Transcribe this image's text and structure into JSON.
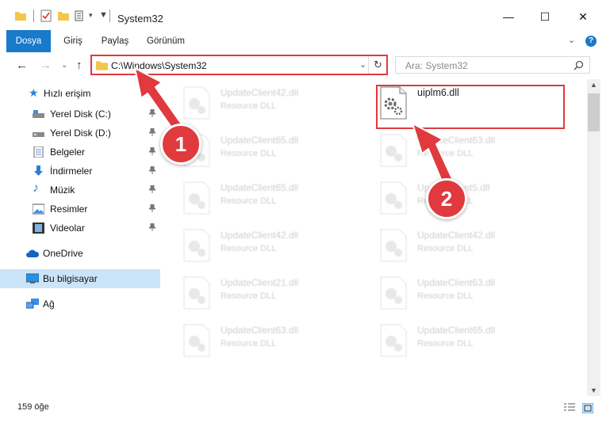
{
  "window": {
    "title": "System32",
    "controls": {
      "minimize": "—",
      "maximize": "☐",
      "close": "✕"
    }
  },
  "ribbon": {
    "tabs": [
      "Dosya",
      "Giriş",
      "Paylaş",
      "Görünüm"
    ]
  },
  "navigation": {
    "address": "C:\\Windows\\System32",
    "search_placeholder": "Ara: System32"
  },
  "sidebar": {
    "quick_access": "Hızlı erişim",
    "items": [
      {
        "label": "Yerel Disk (C:)",
        "icon": "drive-icon",
        "pinned": true
      },
      {
        "label": "Yerel Disk (D:)",
        "icon": "drive-icon",
        "pinned": true
      },
      {
        "label": "Belgeler",
        "icon": "documents-icon",
        "pinned": true
      },
      {
        "label": "İndirmeler",
        "icon": "downloads-icon",
        "pinned": true
      },
      {
        "label": "Müzik",
        "icon": "music-icon",
        "pinned": true
      },
      {
        "label": "Resimler",
        "icon": "pictures-icon",
        "pinned": true
      },
      {
        "label": "Videolar",
        "icon": "videos-icon",
        "pinned": true
      }
    ],
    "onedrive": "OneDrive",
    "this_pc": "Bu bilgisayar",
    "network": "Ağ"
  },
  "files": {
    "target": {
      "name": "uiplm6.dll"
    },
    "left_column": [
      {
        "name": "UpdateClient42.dll",
        "type": "Resource DLL"
      },
      {
        "name": "UpdateClient65.dll",
        "type": "Resource DLL"
      },
      {
        "name": "UpdateClient65.dll",
        "type": "Resource DLL"
      },
      {
        "name": "UpdateClient42.dll",
        "type": "Resource DLL"
      },
      {
        "name": "UpdateClient21.dll",
        "type": "Resource DLL"
      },
      {
        "name": "UpdateClient63.dll",
        "type": "Resource DLL"
      }
    ],
    "right_column": [
      {
        "name": "UpdateClient63.dll",
        "type": "Resource DLL"
      },
      {
        "name": "UpdateClient5.dll",
        "type": "Resource DLL"
      },
      {
        "name": "UpdateClient42.dll",
        "type": "Resource DLL"
      },
      {
        "name": "UpdateClient63.dll",
        "type": "Resource DLL"
      },
      {
        "name": "UpdateClient65.dll",
        "type": "Resource DLL"
      }
    ]
  },
  "annotations": {
    "step1": "1",
    "step2": "2",
    "accent": "#e03a3e"
  },
  "status": {
    "count": "159 öğe"
  }
}
